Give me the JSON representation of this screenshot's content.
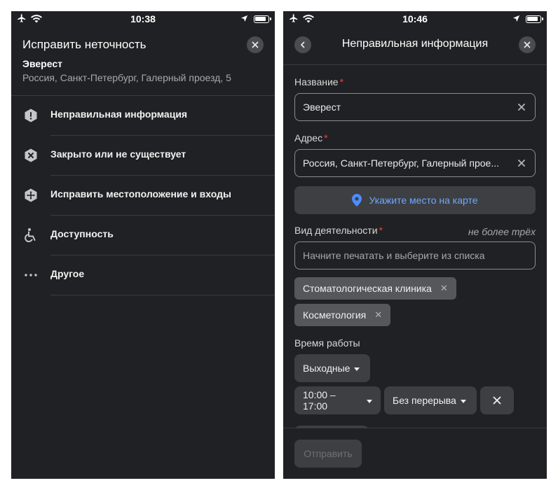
{
  "left_screen": {
    "status": {
      "time": "10:38"
    },
    "title": "Исправить неточность",
    "place": {
      "name": "Эверест",
      "address": "Россия, Санкт-Петербург, Галерный проезд, 5"
    },
    "menu": [
      {
        "label": "Неправильная информация",
        "icon": "alert-hexagon-icon"
      },
      {
        "label": "Закрыто или не существует",
        "icon": "closed-hexagon-icon"
      },
      {
        "label": "Исправить местоположение и входы",
        "icon": "move-location-icon"
      },
      {
        "label": "Доступность",
        "icon": "wheelchair-icon"
      },
      {
        "label": "Другое",
        "icon": "more-dots-icon"
      }
    ]
  },
  "right_screen": {
    "status": {
      "time": "10:46"
    },
    "title": "Неправильная информация",
    "name_field": {
      "label": "Название",
      "required": "*",
      "value": "Эверест"
    },
    "address_field": {
      "label": "Адрес",
      "required": "*",
      "value": "Россия, Санкт-Петербург, Галерный прое..."
    },
    "map_button": {
      "label": "Укажите место на карте"
    },
    "activity": {
      "label": "Вид деятельности",
      "required": "*",
      "hint": "не более трёх",
      "placeholder": "Начните печатать и выберите из списка",
      "chips": [
        {
          "label": "Стоматологическая клиника",
          "remove": "✕"
        },
        {
          "label": "Косметология",
          "remove": "✕"
        }
      ]
    },
    "hours": {
      "label": "Время работы",
      "days": "Выходные",
      "time_range": "10:00 – 17:00",
      "break": "Без перерыва"
    },
    "submit": {
      "label": "Отправить"
    }
  },
  "colors": {
    "background": "#202124",
    "accent_link": "#6fa7ff",
    "required": "#f2403c",
    "map_pin": "#4c8dff"
  }
}
